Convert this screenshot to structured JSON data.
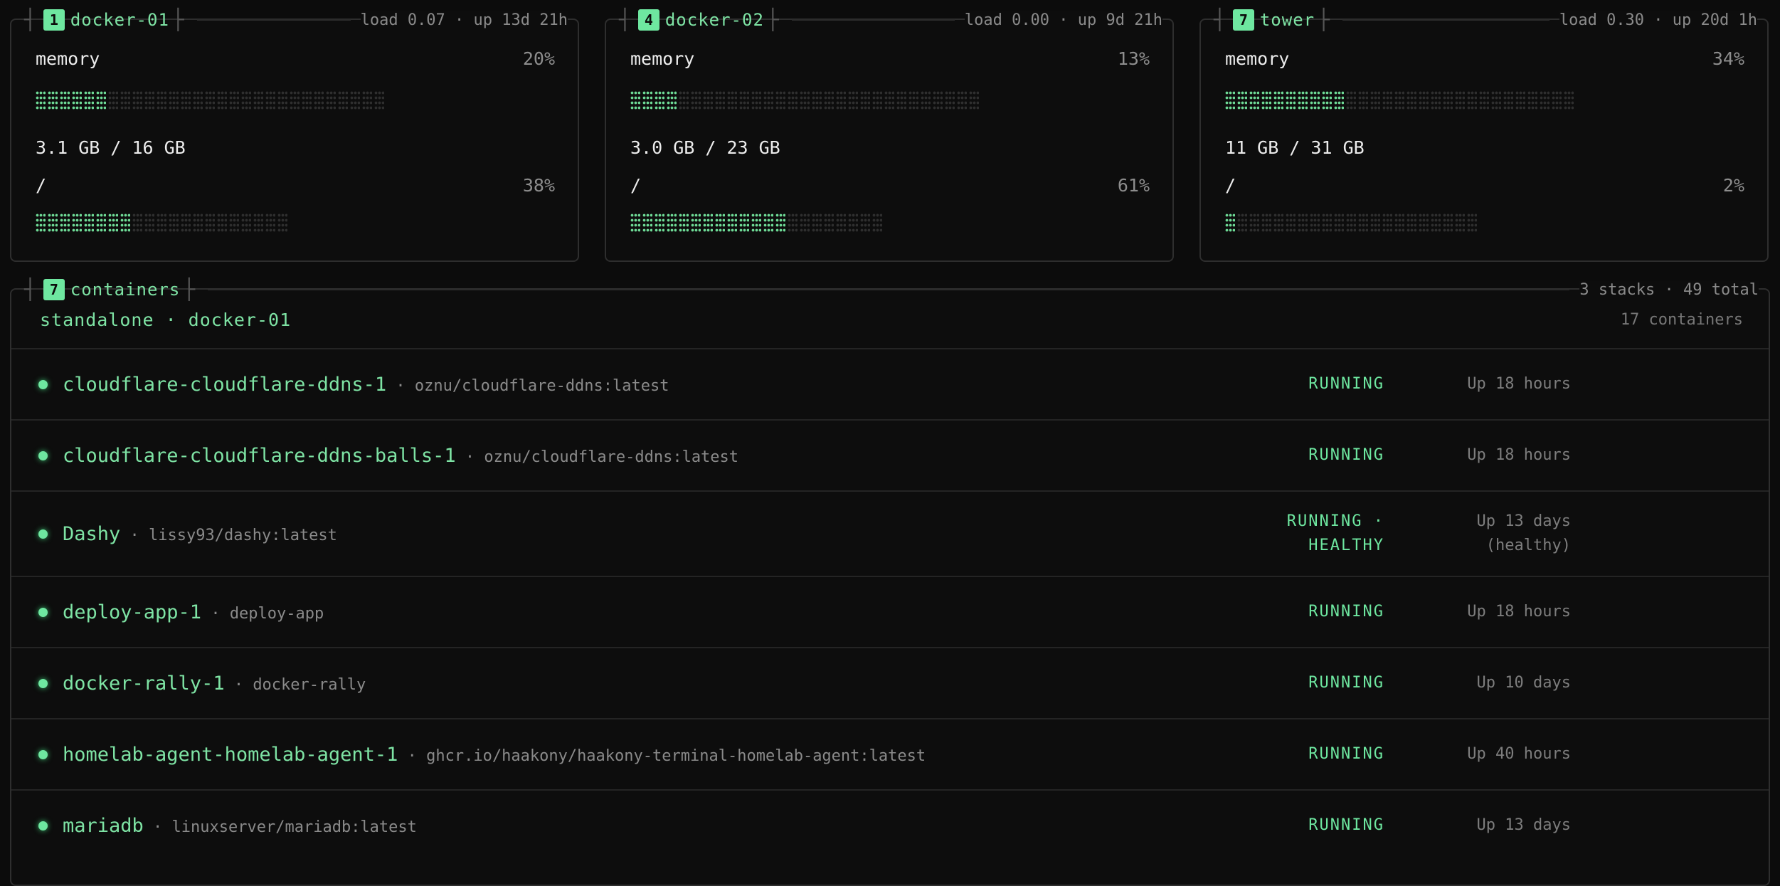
{
  "hosts": [
    {
      "index": "1",
      "name": "docker-01",
      "meta": "load 0.07 · up 13d 21h",
      "memory": {
        "label": "memory",
        "percent": 20,
        "percent_label": "20%",
        "usage": "3.1 GB / 16 GB"
      },
      "disk": {
        "label": "/",
        "percent": 38,
        "percent_label": "38%"
      }
    },
    {
      "index": "4",
      "name": "docker-02",
      "meta": "load 0.00 · up 9d 21h",
      "memory": {
        "label": "memory",
        "percent": 13,
        "percent_label": "13%",
        "usage": "3.0 GB / 23 GB"
      },
      "disk": {
        "label": "/",
        "percent": 61,
        "percent_label": "61%"
      }
    },
    {
      "index": "7",
      "name": "tower",
      "meta": "load 0.30 · up 20d 1h",
      "memory": {
        "label": "memory",
        "percent": 34,
        "percent_label": "34%",
        "usage": "11 GB / 31 GB"
      },
      "disk": {
        "label": "/",
        "percent": 2,
        "percent_label": "2%"
      }
    }
  ],
  "containers_panel": {
    "index": "7",
    "title": "containers",
    "meta": "3 stacks · 49 total",
    "group_title": "standalone · docker-01",
    "group_count": "17 containers",
    "rows": [
      {
        "name": "cloudflare-cloudflare-ddns-1",
        "image": " · oznu/cloudflare-ddns:latest",
        "state": "RUNNING",
        "uptime": "Up 18 hours"
      },
      {
        "name": "cloudflare-cloudflare-ddns-balls-1",
        "image": " · oznu/cloudflare-ddns:latest",
        "state": "RUNNING",
        "uptime": "Up 18 hours"
      },
      {
        "name": "Dashy",
        "image": " · lissy93/dashy:latest",
        "state": "RUNNING ·\nHEALTHY",
        "uptime": "Up 13 days\n(healthy)"
      },
      {
        "name": "deploy-app-1",
        "image": " · deploy-app",
        "state": "RUNNING",
        "uptime": "Up 18 hours"
      },
      {
        "name": "docker-rally-1",
        "image": " · docker-rally",
        "state": "RUNNING",
        "uptime": "Up 10 days"
      },
      {
        "name": "homelab-agent-homelab-agent-1",
        "image": " · ghcr.io/haakony/haakony-terminal-homelab-agent:latest",
        "state": "RUNNING",
        "uptime": "Up 40 hours"
      },
      {
        "name": "mariadb",
        "image": " · linuxserver/mariadb:latest",
        "state": "RUNNING",
        "uptime": "Up 13 days"
      }
    ]
  }
}
